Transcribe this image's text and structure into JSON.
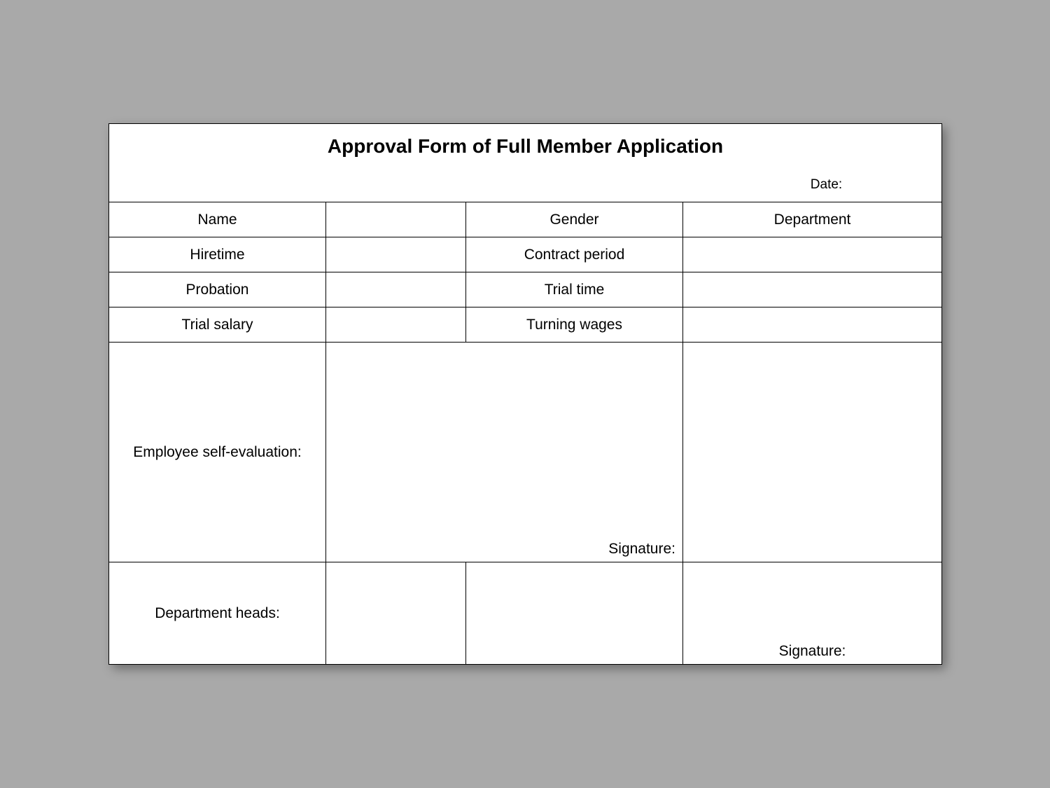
{
  "form": {
    "title": "Approval Form of Full Member Application",
    "date_label": "Date:",
    "fields": {
      "name": "Name",
      "gender": "Gender",
      "department": "Department",
      "hiretime": "Hiretime",
      "contract_period": "Contract period",
      "probation": "Probation",
      "trial_time": "Trial time",
      "trial_salary": "Trial salary",
      "turning_wages": "Turning wages"
    },
    "sections": {
      "self_eval": "Employee self-evaluation:",
      "dept_heads": "Department heads:"
    },
    "signature_label": "Signature:"
  }
}
